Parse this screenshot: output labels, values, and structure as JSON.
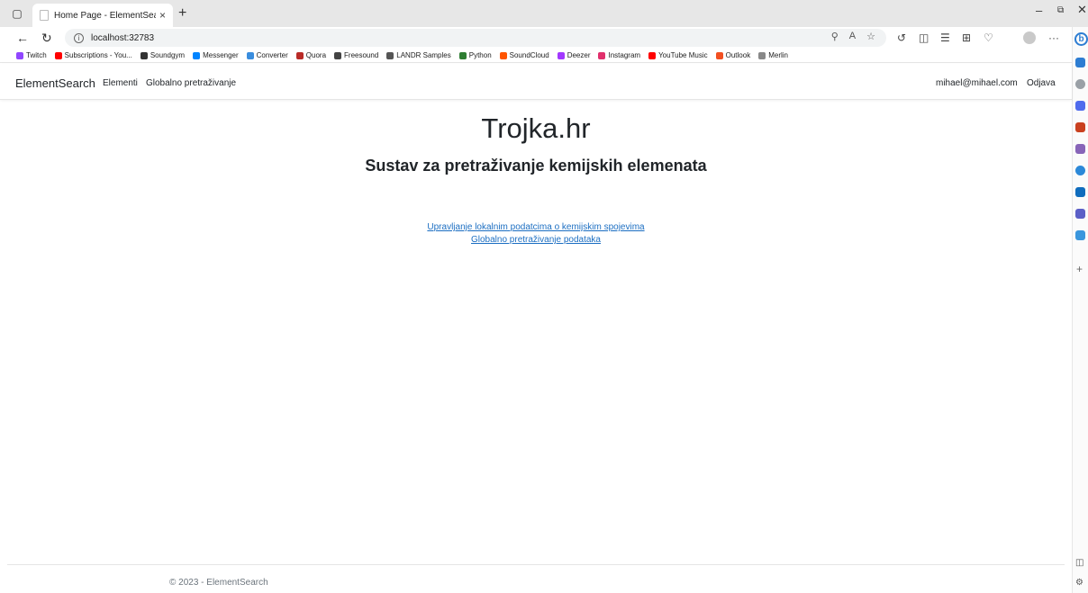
{
  "browser": {
    "tab_title": "Home Page - ElementSearch",
    "url": "localhost:32783",
    "bookmarks": [
      {
        "label": "Twitch",
        "color": "#9146ff"
      },
      {
        "label": "Subscriptions - You...",
        "color": "#ff0000"
      },
      {
        "label": "Soundgym",
        "color": "#333333"
      },
      {
        "label": "Messenger",
        "color": "#0084ff"
      },
      {
        "label": "Converter",
        "color": "#3a8dde"
      },
      {
        "label": "Quora",
        "color": "#b92b27"
      },
      {
        "label": "Freesound",
        "color": "#444444"
      },
      {
        "label": "LANDR Samples",
        "color": "#555555"
      },
      {
        "label": "Python",
        "color": "#2e7d32"
      },
      {
        "label": "SoundCloud",
        "color": "#ff5500"
      },
      {
        "label": "Deezer",
        "color": "#a238ff"
      },
      {
        "label": "Instagram",
        "color": "#e1306c"
      },
      {
        "label": "YouTube Music",
        "color": "#ff0000"
      },
      {
        "label": "Outlook",
        "color": "#f25022"
      },
      {
        "label": "Merlin",
        "color": "#888888"
      }
    ]
  },
  "navbar": {
    "brand": "ElementSearch",
    "links": [
      "Elementi",
      "Globalno pretraživanje"
    ],
    "user_email": "mihael@mihael.com",
    "logout": "Odjava"
  },
  "main": {
    "title": "Trojka.hr",
    "subtitle": "Sustav za pretraživanje kemijskih elemenata",
    "links": [
      "Upravljanje lokalnim podatcima o kemijskim spojevima",
      "Globalno pretraživanje podataka"
    ]
  },
  "footer": {
    "text": "© 2023 - ElementSearch"
  },
  "colors": {
    "link": "#1b6ec2",
    "text": "#212529"
  }
}
